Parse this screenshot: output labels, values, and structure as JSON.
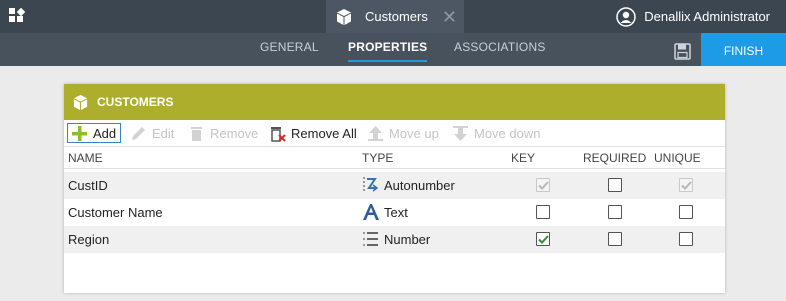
{
  "topbar": {
    "doc_tab_title": "Customers",
    "user_name": "Denallix Administrator"
  },
  "subnav": {
    "tabs": [
      "GENERAL",
      "PROPERTIES",
      "ASSOCIATIONS"
    ],
    "active_tab": "PROPERTIES",
    "finish_label": "FINISH"
  },
  "card": {
    "title": "CUSTOMERS",
    "toolbar": {
      "add": "Add",
      "edit": "Edit",
      "remove": "Remove",
      "remove_all": "Remove All",
      "move_up": "Move up",
      "move_down": "Move down"
    },
    "columns": {
      "name": "NAME",
      "type": "TYPE",
      "key": "KEY",
      "required": "REQUIRED",
      "unique": "UNIQUE"
    },
    "rows": [
      {
        "name": "CustID",
        "type": "Autonumber",
        "type_icon": "autonumber-icon",
        "key": true,
        "key_disabled": true,
        "required": false,
        "unique": true,
        "unique_disabled": true
      },
      {
        "name": "Customer Name",
        "type": "Text",
        "type_icon": "text-type-icon",
        "key": false,
        "required": false,
        "unique": false
      },
      {
        "name": "Region",
        "type": "Number",
        "type_icon": "number-type-icon",
        "key": true,
        "required": false,
        "unique": false
      }
    ]
  },
  "colors": {
    "topbar": "#3c4651",
    "subnav": "#48525d",
    "accent": "#1e9be5",
    "card_header": "#adae2c",
    "check_green": "#2e8b3a"
  }
}
